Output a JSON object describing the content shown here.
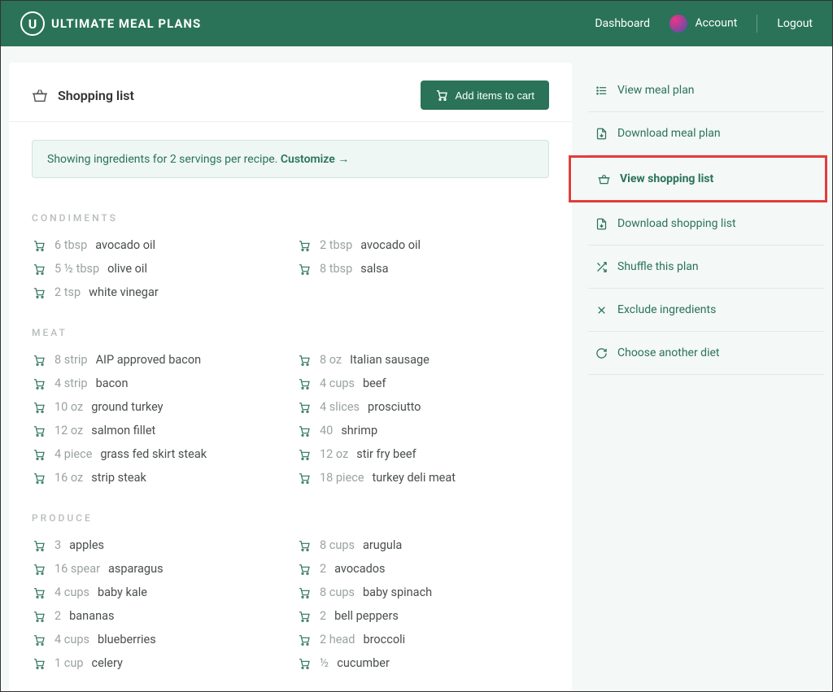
{
  "brand": "ULTIMATE MEAL PLANS",
  "nav": {
    "dashboard": "Dashboard",
    "account": "Account",
    "logout": "Logout"
  },
  "page_title": "Shopping list",
  "add_button": "Add items to cart",
  "banner": {
    "text": "Showing ingredients for 2 servings per recipe. ",
    "link": "Customize →"
  },
  "sections": [
    {
      "title": "CONDIMENTS",
      "left": [
        {
          "qty": "6 tbsp",
          "name": "avocado oil"
        },
        {
          "qty": "5 ½ tbsp",
          "name": "olive oil"
        },
        {
          "qty": "2 tsp",
          "name": "white vinegar"
        }
      ],
      "right": [
        {
          "qty": "2 tbsp",
          "name": "avocado oil"
        },
        {
          "qty": "8 tbsp",
          "name": "salsa"
        }
      ]
    },
    {
      "title": "MEAT",
      "left": [
        {
          "qty": "8 strip",
          "name": "AIP approved bacon"
        },
        {
          "qty": "4 strip",
          "name": "bacon"
        },
        {
          "qty": "10 oz",
          "name": "ground turkey"
        },
        {
          "qty": "12 oz",
          "name": "salmon fillet"
        },
        {
          "qty": "4 piece",
          "name": "grass fed skirt steak"
        },
        {
          "qty": "16 oz",
          "name": "strip steak"
        }
      ],
      "right": [
        {
          "qty": "8 oz",
          "name": "Italian sausage"
        },
        {
          "qty": "4 cups",
          "name": "beef"
        },
        {
          "qty": "4 slices",
          "name": "prosciutto"
        },
        {
          "qty": "40",
          "name": "shrimp"
        },
        {
          "qty": "12 oz",
          "name": "stir fry beef"
        },
        {
          "qty": "18 piece",
          "name": "turkey deli meat"
        }
      ]
    },
    {
      "title": "PRODUCE",
      "left": [
        {
          "qty": "3",
          "name": "apples"
        },
        {
          "qty": "16 spear",
          "name": "asparagus"
        },
        {
          "qty": "4 cups",
          "name": "baby kale"
        },
        {
          "qty": "2",
          "name": "bananas"
        },
        {
          "qty": "4 cups",
          "name": "blueberries"
        },
        {
          "qty": "1 cup",
          "name": "celery"
        }
      ],
      "right": [
        {
          "qty": "8 cups",
          "name": "arugula"
        },
        {
          "qty": "2",
          "name": "avocados"
        },
        {
          "qty": "8 cups",
          "name": "baby spinach"
        },
        {
          "qty": "2",
          "name": "bell peppers"
        },
        {
          "qty": "2 head",
          "name": "broccoli"
        },
        {
          "qty": "½",
          "name": "cucumber"
        }
      ]
    }
  ],
  "sidebar": [
    {
      "icon": "list",
      "label": "View meal plan",
      "active": false
    },
    {
      "icon": "download",
      "label": "Download meal plan",
      "active": false
    },
    {
      "icon": "basket",
      "label": "View shopping list",
      "active": true
    },
    {
      "icon": "download",
      "label": "Download shopping list",
      "active": false
    },
    {
      "icon": "shuffle",
      "label": "Shuffle this plan",
      "active": false
    },
    {
      "icon": "x",
      "label": "Exclude ingredients",
      "active": false
    },
    {
      "icon": "refresh",
      "label": "Choose another diet",
      "active": false
    }
  ]
}
